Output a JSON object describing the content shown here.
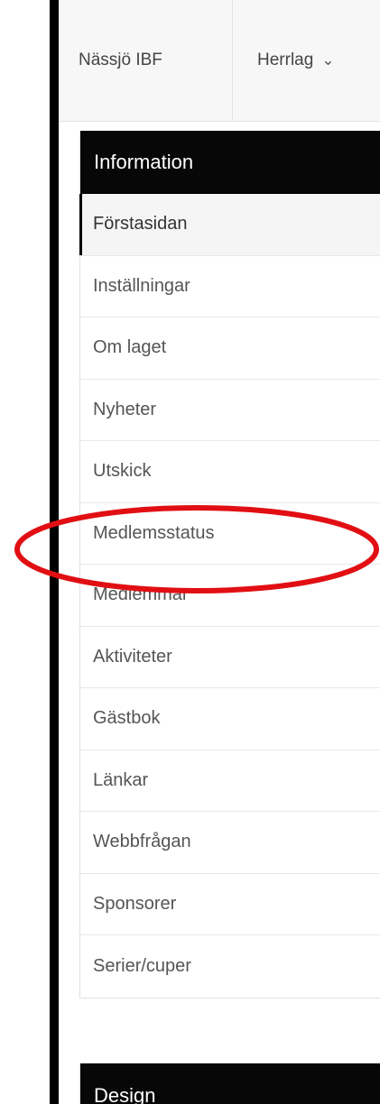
{
  "topbar": {
    "team_name": "Nässjö IBF",
    "team_select": {
      "value": "Herrlag",
      "icon": "chevron-down-icon"
    }
  },
  "information_section": {
    "title": "Information",
    "items": [
      {
        "label": "Förstasidan",
        "active": true
      },
      {
        "label": "Inställningar"
      },
      {
        "label": "Om laget"
      },
      {
        "label": "Nyheter"
      },
      {
        "label": "Utskick"
      },
      {
        "label": "Medlemsstatus"
      },
      {
        "label": "Medlemmar",
        "highlighted": true
      },
      {
        "label": "Aktiviteter"
      },
      {
        "label": "Gästbok"
      },
      {
        "label": "Länkar"
      },
      {
        "label": "Webbfrågan"
      },
      {
        "label": "Sponsorer"
      },
      {
        "label": "Serier/cuper"
      }
    ]
  },
  "design_section": {
    "title": "Design"
  },
  "annotation": {
    "shape": "ellipse",
    "color": "#e10f13"
  }
}
